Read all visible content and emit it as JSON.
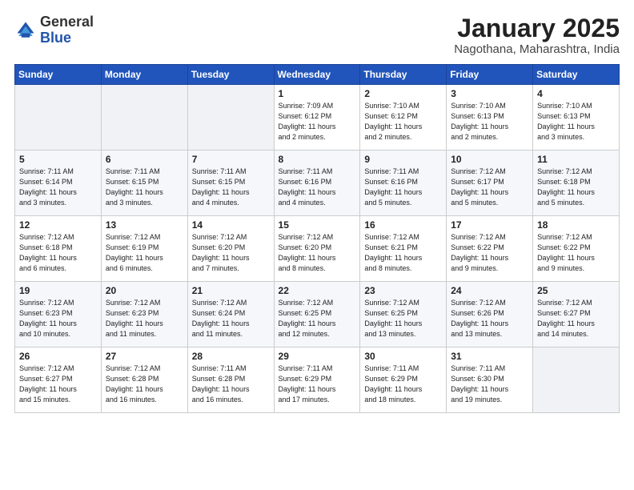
{
  "logo": {
    "general": "General",
    "blue": "Blue"
  },
  "title": {
    "month": "January 2025",
    "location": "Nagothana, Maharashtra, India"
  },
  "weekdays": [
    "Sunday",
    "Monday",
    "Tuesday",
    "Wednesday",
    "Thursday",
    "Friday",
    "Saturday"
  ],
  "weeks": [
    [
      {
        "day": "",
        "info": ""
      },
      {
        "day": "",
        "info": ""
      },
      {
        "day": "",
        "info": ""
      },
      {
        "day": "1",
        "info": "Sunrise: 7:09 AM\nSunset: 6:12 PM\nDaylight: 11 hours\nand 2 minutes."
      },
      {
        "day": "2",
        "info": "Sunrise: 7:10 AM\nSunset: 6:12 PM\nDaylight: 11 hours\nand 2 minutes."
      },
      {
        "day": "3",
        "info": "Sunrise: 7:10 AM\nSunset: 6:13 PM\nDaylight: 11 hours\nand 2 minutes."
      },
      {
        "day": "4",
        "info": "Sunrise: 7:10 AM\nSunset: 6:13 PM\nDaylight: 11 hours\nand 3 minutes."
      }
    ],
    [
      {
        "day": "5",
        "info": "Sunrise: 7:11 AM\nSunset: 6:14 PM\nDaylight: 11 hours\nand 3 minutes."
      },
      {
        "day": "6",
        "info": "Sunrise: 7:11 AM\nSunset: 6:15 PM\nDaylight: 11 hours\nand 3 minutes."
      },
      {
        "day": "7",
        "info": "Sunrise: 7:11 AM\nSunset: 6:15 PM\nDaylight: 11 hours\nand 4 minutes."
      },
      {
        "day": "8",
        "info": "Sunrise: 7:11 AM\nSunset: 6:16 PM\nDaylight: 11 hours\nand 4 minutes."
      },
      {
        "day": "9",
        "info": "Sunrise: 7:11 AM\nSunset: 6:16 PM\nDaylight: 11 hours\nand 5 minutes."
      },
      {
        "day": "10",
        "info": "Sunrise: 7:12 AM\nSunset: 6:17 PM\nDaylight: 11 hours\nand 5 minutes."
      },
      {
        "day": "11",
        "info": "Sunrise: 7:12 AM\nSunset: 6:18 PM\nDaylight: 11 hours\nand 5 minutes."
      }
    ],
    [
      {
        "day": "12",
        "info": "Sunrise: 7:12 AM\nSunset: 6:18 PM\nDaylight: 11 hours\nand 6 minutes."
      },
      {
        "day": "13",
        "info": "Sunrise: 7:12 AM\nSunset: 6:19 PM\nDaylight: 11 hours\nand 6 minutes."
      },
      {
        "day": "14",
        "info": "Sunrise: 7:12 AM\nSunset: 6:20 PM\nDaylight: 11 hours\nand 7 minutes."
      },
      {
        "day": "15",
        "info": "Sunrise: 7:12 AM\nSunset: 6:20 PM\nDaylight: 11 hours\nand 8 minutes."
      },
      {
        "day": "16",
        "info": "Sunrise: 7:12 AM\nSunset: 6:21 PM\nDaylight: 11 hours\nand 8 minutes."
      },
      {
        "day": "17",
        "info": "Sunrise: 7:12 AM\nSunset: 6:22 PM\nDaylight: 11 hours\nand 9 minutes."
      },
      {
        "day": "18",
        "info": "Sunrise: 7:12 AM\nSunset: 6:22 PM\nDaylight: 11 hours\nand 9 minutes."
      }
    ],
    [
      {
        "day": "19",
        "info": "Sunrise: 7:12 AM\nSunset: 6:23 PM\nDaylight: 11 hours\nand 10 minutes."
      },
      {
        "day": "20",
        "info": "Sunrise: 7:12 AM\nSunset: 6:23 PM\nDaylight: 11 hours\nand 11 minutes."
      },
      {
        "day": "21",
        "info": "Sunrise: 7:12 AM\nSunset: 6:24 PM\nDaylight: 11 hours\nand 11 minutes."
      },
      {
        "day": "22",
        "info": "Sunrise: 7:12 AM\nSunset: 6:25 PM\nDaylight: 11 hours\nand 12 minutes."
      },
      {
        "day": "23",
        "info": "Sunrise: 7:12 AM\nSunset: 6:25 PM\nDaylight: 11 hours\nand 13 minutes."
      },
      {
        "day": "24",
        "info": "Sunrise: 7:12 AM\nSunset: 6:26 PM\nDaylight: 11 hours\nand 13 minutes."
      },
      {
        "day": "25",
        "info": "Sunrise: 7:12 AM\nSunset: 6:27 PM\nDaylight: 11 hours\nand 14 minutes."
      }
    ],
    [
      {
        "day": "26",
        "info": "Sunrise: 7:12 AM\nSunset: 6:27 PM\nDaylight: 11 hours\nand 15 minutes."
      },
      {
        "day": "27",
        "info": "Sunrise: 7:12 AM\nSunset: 6:28 PM\nDaylight: 11 hours\nand 16 minutes."
      },
      {
        "day": "28",
        "info": "Sunrise: 7:11 AM\nSunset: 6:28 PM\nDaylight: 11 hours\nand 16 minutes."
      },
      {
        "day": "29",
        "info": "Sunrise: 7:11 AM\nSunset: 6:29 PM\nDaylight: 11 hours\nand 17 minutes."
      },
      {
        "day": "30",
        "info": "Sunrise: 7:11 AM\nSunset: 6:29 PM\nDaylight: 11 hours\nand 18 minutes."
      },
      {
        "day": "31",
        "info": "Sunrise: 7:11 AM\nSunset: 6:30 PM\nDaylight: 11 hours\nand 19 minutes."
      },
      {
        "day": "",
        "info": ""
      }
    ]
  ]
}
